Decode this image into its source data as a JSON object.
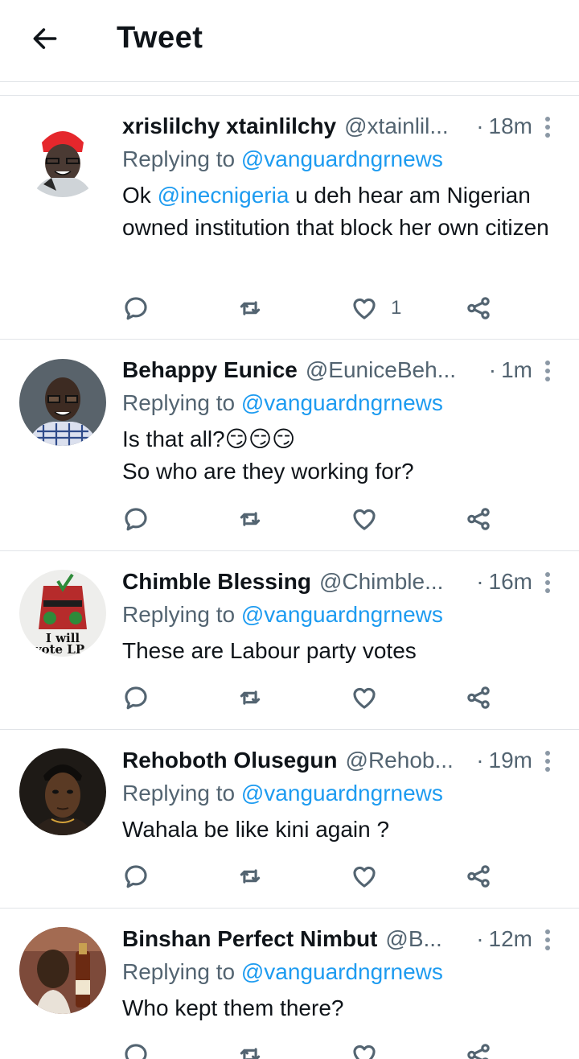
{
  "header": {
    "title": "Tweet"
  },
  "tweets": [
    {
      "name": "xrislilchy xtainlilchy",
      "handle": "@xtainlil...",
      "separator": "·",
      "time": "18m",
      "replying_prefix": "Replying to ",
      "replying_to": "@vanguardngrnews",
      "body_mention": "@inecnigeria",
      "body_after": " u deh hear am Nigerian owned institution that block her own citizen",
      "body_before": "Ok ",
      "like_count": "1"
    },
    {
      "name": "Behappy Eunice",
      "handle": "@EuniceBeh...",
      "separator": "·",
      "time": "1m",
      "replying_prefix": "Replying to ",
      "replying_to": "@vanguardngrnews",
      "body_line1": "Is that all?😏😏😏",
      "body_line2": "So who are they working for?"
    },
    {
      "name": "Chimble Blessing",
      "handle": "@Chimble...",
      "separator": "·",
      "time": "16m",
      "replying_prefix": "Replying to ",
      "replying_to": "@vanguardngrnews",
      "body": "These are Labour party votes",
      "avatar_text_1": "I will",
      "avatar_text_2": "vote LP"
    },
    {
      "name": "Rehoboth Olusegun",
      "handle": "@Rehob...",
      "separator": "·",
      "time": "19m",
      "replying_prefix": "Replying to ",
      "replying_to": "@vanguardngrnews",
      "body": "Wahala be like kini again ?"
    },
    {
      "name": "Binshan Perfect Nimbut",
      "handle": "@B...",
      "separator": "·",
      "time": "12m",
      "replying_prefix": "Replying to ",
      "replying_to": "@vanguardngrnews",
      "body": "Who kept them there?"
    }
  ],
  "icons": {
    "back": "arrow-left-icon",
    "more": "more-vertical-icon",
    "reply": "reply-icon",
    "retweet": "retweet-icon",
    "like": "heart-icon",
    "share": "share-icon"
  },
  "colors": {
    "link": "#1d9bf0",
    "secondary_text": "#536471",
    "divider": "#e1e4e8"
  }
}
